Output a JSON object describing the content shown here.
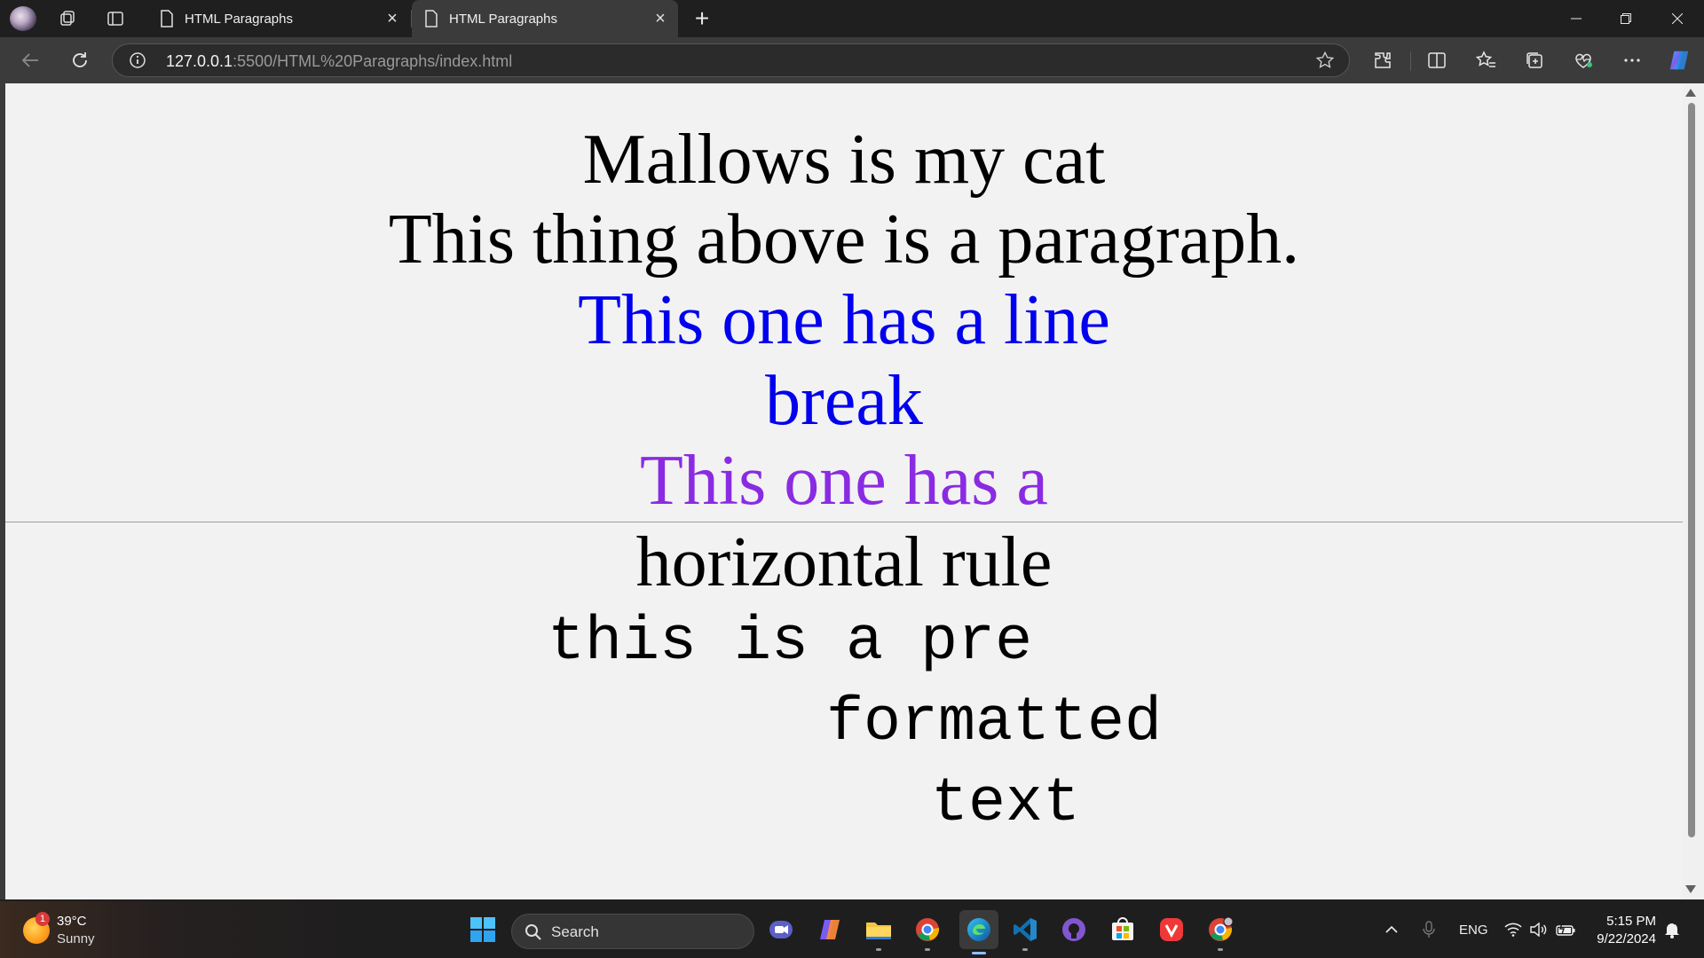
{
  "browser": {
    "tabs": [
      {
        "title": "HTML Paragraphs",
        "active": false
      },
      {
        "title": "HTML Paragraphs",
        "active": true
      }
    ],
    "url_host": "127.0.0.1",
    "url_rest": ":5500/HTML%20Paragraphs/index.html"
  },
  "page": {
    "heading1": "Mallows is my cat",
    "paragraph": "This thing above is a paragraph.",
    "line_break_part1": "This one has a line",
    "line_break_part2": "break",
    "hr_part1": "This one has a",
    "hr_part2": "horizontal rule",
    "pre_line1": "this is a pre",
    "pre_line2": "formatted",
    "pre_line3": "text",
    "colors": {
      "black": "#000000",
      "blue": "#0000ee",
      "purple": "#8a2be2"
    }
  },
  "taskbar": {
    "weather_temp": "39°C",
    "weather_condition": "Sunny",
    "weather_badge": "1",
    "search_label": "Search",
    "language": "ENG",
    "time": "5:15 PM",
    "date": "9/22/2024"
  }
}
